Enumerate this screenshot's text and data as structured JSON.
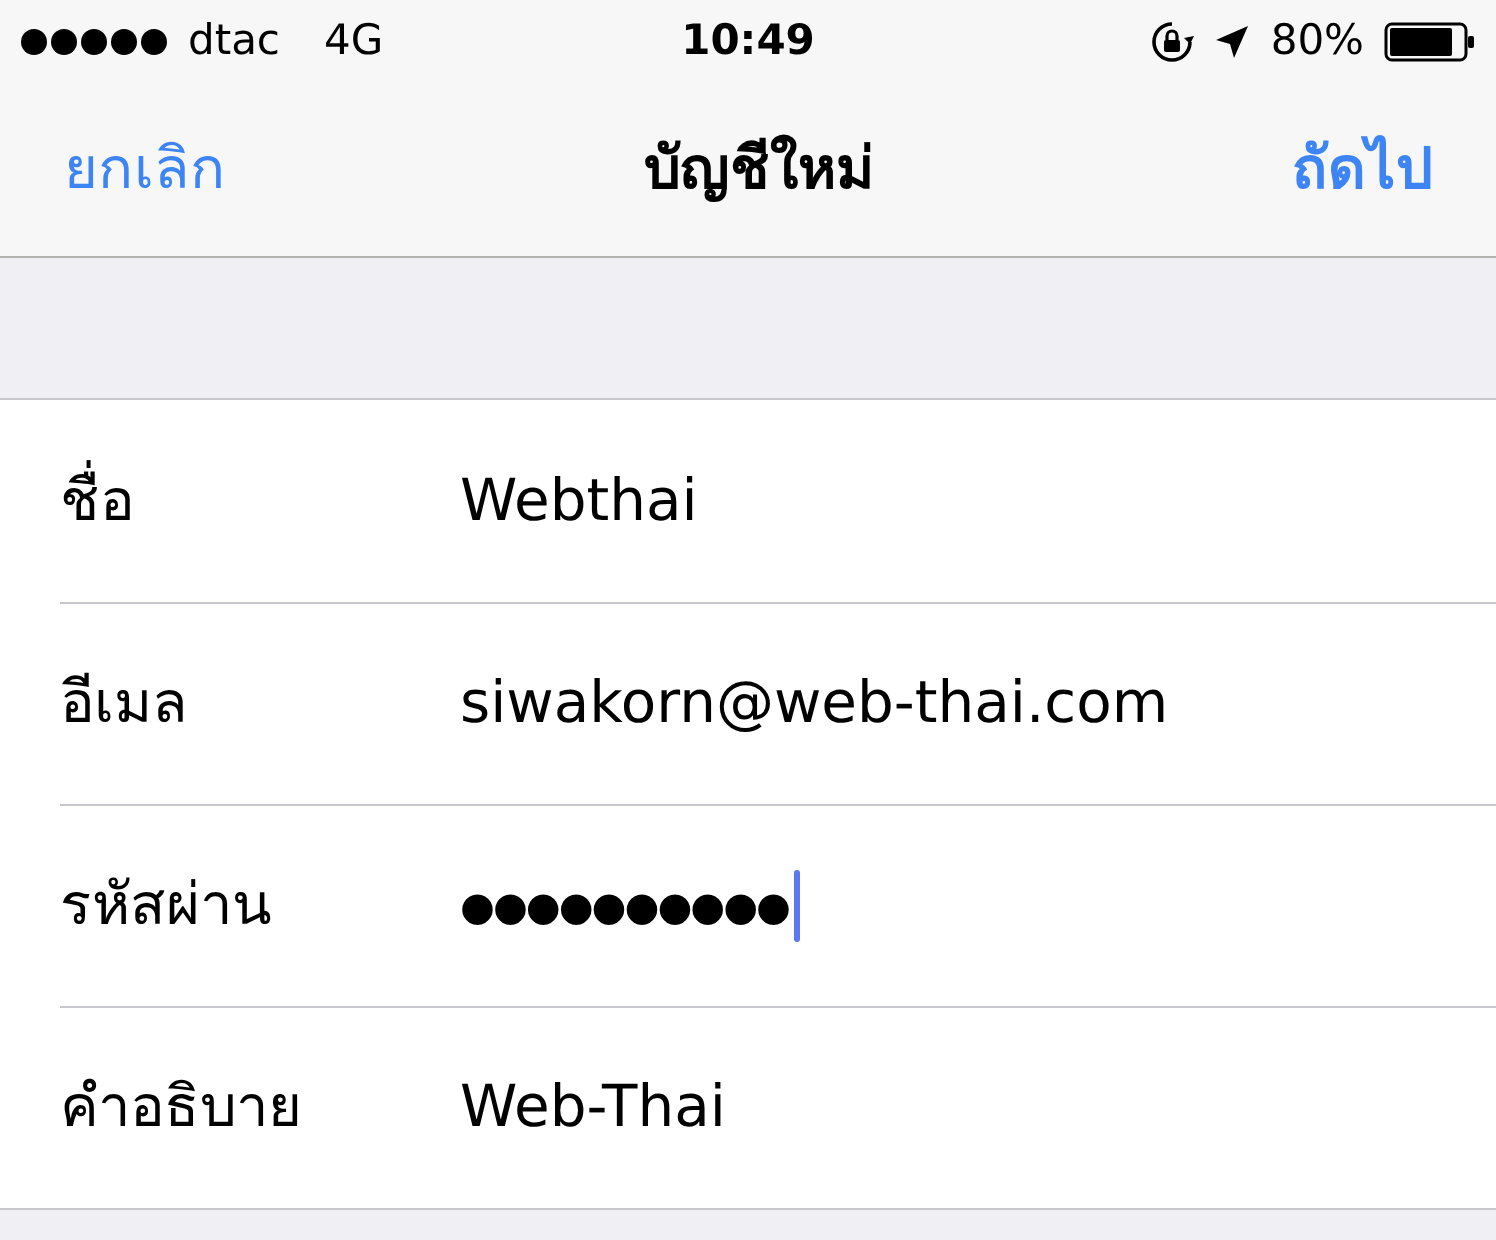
{
  "status_bar": {
    "carrier": "dtac",
    "network": "4G",
    "time": "10:49",
    "battery": "80%"
  },
  "nav": {
    "cancel": "ยกเลิก",
    "title": "บัญชีใหม่",
    "next": "ถัดไป"
  },
  "fields": [
    {
      "label": "ชื่อ",
      "value": "Webthai",
      "focused": false
    },
    {
      "label": "อีเมล",
      "value": "siwakorn@web-thai.com",
      "focused": false
    },
    {
      "label": "รหัสผ่าน",
      "value": "●●●●●●●●●●",
      "focused": true,
      "kind": "password"
    },
    {
      "label": "คำอธิบาย",
      "value": "Web-Thai",
      "focused": false
    }
  ]
}
